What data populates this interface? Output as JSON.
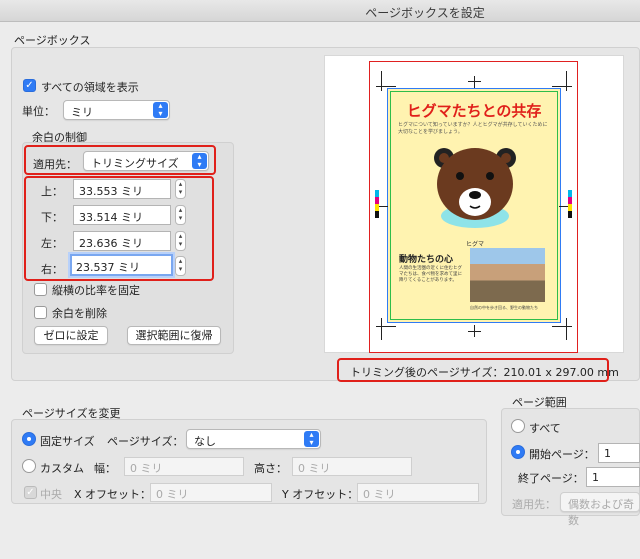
{
  "window": {
    "title": "ページボックスを設定"
  },
  "page_box": {
    "section_label": "ページボックス",
    "show_all_areas_label": "すべての領域を表示",
    "unit_label": "単位：",
    "unit_value": "ミリ",
    "margin_control_label": "余白の制御",
    "apply_to_label": "適用先：",
    "apply_to_value": "トリミングサイズ",
    "margins": [
      {
        "label": "上：",
        "value": "33.553 ミリ"
      },
      {
        "label": "下：",
        "value": "33.514 ミリ"
      },
      {
        "label": "左：",
        "value": "23.636 ミリ"
      },
      {
        "label": "右：",
        "value": "23.537 ミリ"
      }
    ],
    "keep_ratio_label": "縦横の比率を固定",
    "remove_margin_label": "余白を削除",
    "zero_button": "ゼロに設定",
    "restore_button": "選択範囲に復帰"
  },
  "preview": {
    "doc_title": "ヒグマたちとの共存",
    "body_text": "ヒグマについて知っていますか？人とヒグマが共存していくために大切なことを学びましょう。",
    "bear_caption": "ヒグマ",
    "section_heading": "動物たちの心",
    "section_text": "人間の生活圏の近くに住むヒグマたちは、食べ物を求めて里に降りてくることがあります。",
    "photo_caption": "自然の中を歩き回る、野生の動物たち",
    "trimmed_size_text": "トリミング後のページサイズ：210.01 x 297.00 mm"
  },
  "page_size": {
    "section_label": "ページサイズを変更",
    "fixed_label": "固定サイズ",
    "page_size_label": "ページサイズ：",
    "page_size_value": "なし",
    "custom_label": "カスタム",
    "width_label": "幅：",
    "width_placeholder": "0 ミリ",
    "height_label": "高さ：",
    "height_placeholder": "0 ミリ",
    "center_label": "中央",
    "x_offset_label": "X オフセット：",
    "x_offset_placeholder": "0 ミリ",
    "y_offset_label": "Y オフセット：",
    "y_offset_placeholder": "0 ミリ"
  },
  "page_range": {
    "section_label": "ページ範囲",
    "all_label": "すべて",
    "start_label": "開始ページ：",
    "start_value": "1",
    "end_label": "終了ページ：",
    "end_value": "1",
    "apply_label": "適用先：",
    "apply_value": "偶数および奇数"
  },
  "colors": {
    "accent": "#2f7bf5",
    "highlight": "#e0201a",
    "preview_bg": "#fff3b0"
  }
}
